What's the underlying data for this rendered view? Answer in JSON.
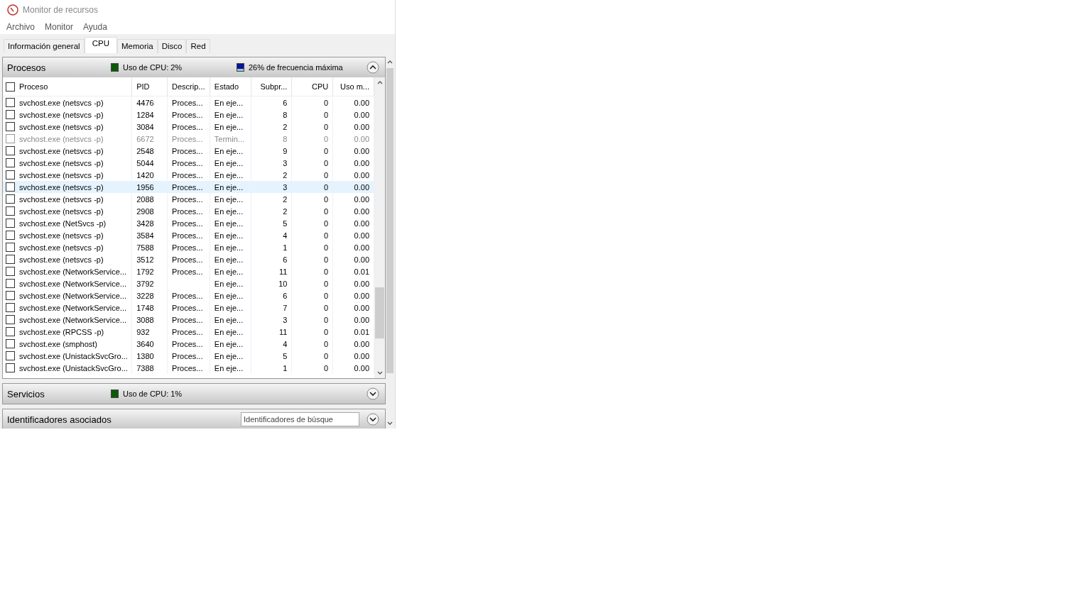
{
  "window": {
    "title": "Monitor de recursos"
  },
  "menu": [
    "Archivo",
    "Monitor",
    "Ayuda"
  ],
  "tabs": [
    {
      "label": "Información general",
      "selected": false
    },
    {
      "label": "CPU",
      "selected": true
    },
    {
      "label": "Memoria",
      "selected": false
    },
    {
      "label": "Disco",
      "selected": false
    },
    {
      "label": "Red",
      "selected": false
    }
  ],
  "processes": {
    "title": "Procesos",
    "usage": "Uso de CPU: 2%",
    "frequency": "26% de frecuencia máxima",
    "expanded": true,
    "all_checked": false,
    "columns": [
      "Proceso",
      "PID",
      "Descrip...",
      "Estado",
      "Subpr...",
      "CPU",
      "Uso m..."
    ],
    "rows": [
      {
        "cells": [
          "svchost.exe (netsvcs -p)",
          "4476",
          "Proces...",
          "En eje...",
          "6",
          "0",
          "0.00"
        ],
        "checked": false,
        "selected": false,
        "terminated": false
      },
      {
        "cells": [
          "svchost.exe (netsvcs -p)",
          "1284",
          "Proces...",
          "En eje...",
          "8",
          "0",
          "0.00"
        ],
        "checked": false,
        "selected": false,
        "terminated": false
      },
      {
        "cells": [
          "svchost.exe (netsvcs -p)",
          "3084",
          "Proces...",
          "En eje...",
          "2",
          "0",
          "0.00"
        ],
        "checked": false,
        "selected": false,
        "terminated": false
      },
      {
        "cells": [
          "svchost.exe (netsvcs -p)",
          "6672",
          "Proces...",
          "Termin...",
          "8",
          "0",
          "0.00"
        ],
        "checked": false,
        "selected": false,
        "terminated": true
      },
      {
        "cells": [
          "svchost.exe (netsvcs -p)",
          "2548",
          "Proces...",
          "En eje...",
          "9",
          "0",
          "0.00"
        ],
        "checked": false,
        "selected": false,
        "terminated": false
      },
      {
        "cells": [
          "svchost.exe (netsvcs -p)",
          "5044",
          "Proces...",
          "En eje...",
          "3",
          "0",
          "0.00"
        ],
        "checked": false,
        "selected": false,
        "terminated": false
      },
      {
        "cells": [
          "svchost.exe (netsvcs -p)",
          "1420",
          "Proces...",
          "En eje...",
          "2",
          "0",
          "0.00"
        ],
        "checked": false,
        "selected": false,
        "terminated": false
      },
      {
        "cells": [
          "svchost.exe (netsvcs -p)",
          "1956",
          "Proces...",
          "En eje...",
          "3",
          "0",
          "0.00"
        ],
        "checked": false,
        "selected": true,
        "terminated": false
      },
      {
        "cells": [
          "svchost.exe (netsvcs -p)",
          "2088",
          "Proces...",
          "En eje...",
          "2",
          "0",
          "0.00"
        ],
        "checked": false,
        "selected": false,
        "terminated": false
      },
      {
        "cells": [
          "svchost.exe (netsvcs -p)",
          "2908",
          "Proces...",
          "En eje...",
          "2",
          "0",
          "0.00"
        ],
        "checked": false,
        "selected": false,
        "terminated": false
      },
      {
        "cells": [
          "svchost.exe (NetSvcs -p)",
          "3428",
          "Proces...",
          "En eje...",
          "5",
          "0",
          "0.00"
        ],
        "checked": false,
        "selected": false,
        "terminated": false
      },
      {
        "cells": [
          "svchost.exe (netsvcs -p)",
          "3584",
          "Proces...",
          "En eje...",
          "4",
          "0",
          "0.00"
        ],
        "checked": false,
        "selected": false,
        "terminated": false
      },
      {
        "cells": [
          "svchost.exe (netsvcs -p)",
          "7588",
          "Proces...",
          "En eje...",
          "1",
          "0",
          "0.00"
        ],
        "checked": false,
        "selected": false,
        "terminated": false
      },
      {
        "cells": [
          "svchost.exe (netsvcs -p)",
          "3512",
          "Proces...",
          "En eje...",
          "6",
          "0",
          "0.00"
        ],
        "checked": false,
        "selected": false,
        "terminated": false
      },
      {
        "cells": [
          "svchost.exe (NetworkService...",
          "1792",
          "Proces...",
          "En eje...",
          "11",
          "0",
          "0.01"
        ],
        "checked": false,
        "selected": false,
        "terminated": false
      },
      {
        "cells": [
          "svchost.exe (NetworkService...",
          "3792",
          "",
          "En eje...",
          "10",
          "0",
          "0.00"
        ],
        "checked": false,
        "selected": false,
        "terminated": false
      },
      {
        "cells": [
          "svchost.exe (NetworkService...",
          "3228",
          "Proces...",
          "En eje...",
          "6",
          "0",
          "0.00"
        ],
        "checked": false,
        "selected": false,
        "terminated": false
      },
      {
        "cells": [
          "svchost.exe (NetworkService...",
          "1748",
          "Proces...",
          "En eje...",
          "7",
          "0",
          "0.00"
        ],
        "checked": false,
        "selected": false,
        "terminated": false
      },
      {
        "cells": [
          "svchost.exe (NetworkService...",
          "3088",
          "Proces...",
          "En eje...",
          "3",
          "0",
          "0.00"
        ],
        "checked": false,
        "selected": false,
        "terminated": false
      },
      {
        "cells": [
          "svchost.exe (RPCSS -p)",
          "932",
          "Proces...",
          "En eje...",
          "11",
          "0",
          "0.01"
        ],
        "checked": false,
        "selected": false,
        "terminated": false
      },
      {
        "cells": [
          "svchost.exe (smphost)",
          "3640",
          "Proces...",
          "En eje...",
          "4",
          "0",
          "0.00"
        ],
        "checked": false,
        "selected": false,
        "terminated": false
      },
      {
        "cells": [
          "svchost.exe (UnistackSvcGro...",
          "1380",
          "Proces...",
          "En eje...",
          "5",
          "0",
          "0.00"
        ],
        "checked": false,
        "selected": false,
        "terminated": false
      },
      {
        "cells": [
          "svchost.exe (UnistackSvcGro...",
          "7388",
          "Proces...",
          "En eje...",
          "1",
          "0",
          "0.00"
        ],
        "checked": false,
        "selected": false,
        "terminated": false
      }
    ]
  },
  "services": {
    "title": "Servicios",
    "usage": "Uso de CPU: 1%",
    "expanded": false
  },
  "handles": {
    "title": "Identificadores asociados",
    "search": {
      "placeholder": "Identificadores de búsque"
    },
    "expanded": false
  }
}
